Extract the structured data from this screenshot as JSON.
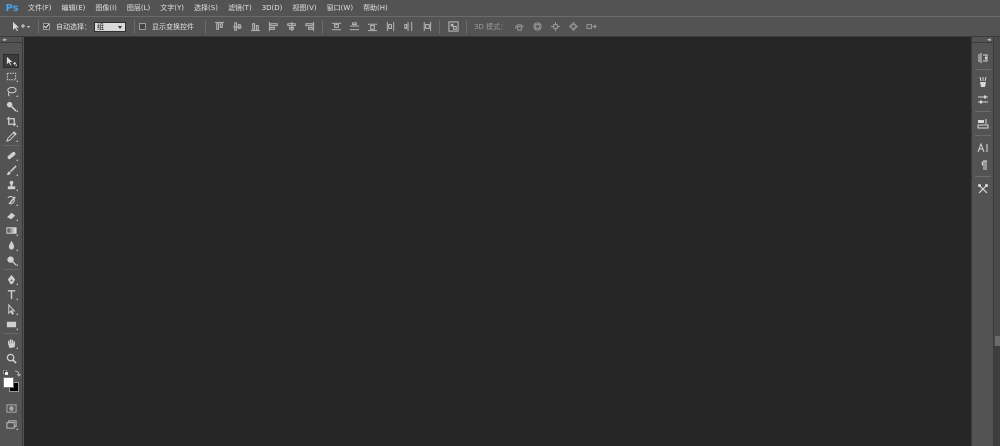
{
  "app": {
    "logo": "Ps"
  },
  "menu": [
    "文件(F)",
    "编辑(E)",
    "图像(I)",
    "图层(L)",
    "文字(Y)",
    "选择(S)",
    "滤镜(T)",
    "3D(D)",
    "视图(V)",
    "窗口(W)",
    "帮助(H)"
  ],
  "options_bar": {
    "auto_select_label": "自动选择：",
    "auto_select_checked": true,
    "auto_select_value": "组",
    "show_transform_label": "显示变换控件",
    "show_transform_checked": false,
    "mode_3d_label": "3D 模式："
  },
  "toolbar": {
    "tools": [
      "move-tool",
      "marquee-tool",
      "lasso-tool",
      "quick-select-tool",
      "crop-tool",
      "eyedropper-tool",
      "spot-healing-tool",
      "brush-tool",
      "clone-stamp-tool",
      "history-brush-tool",
      "eraser-tool",
      "gradient-tool",
      "blur-tool",
      "dodge-tool",
      "pen-tool",
      "type-tool",
      "path-select-tool",
      "rectangle-tool",
      "hand-tool",
      "zoom-tool"
    ],
    "foreground_color": "#ffffff",
    "background_color": "#000000"
  },
  "dock": {
    "panels": [
      "history-panel",
      "brushes-panel",
      "adjustments-panel",
      "properties-panel",
      "character-panel",
      "paragraph-panel",
      "tool-presets-panel"
    ]
  },
  "colors": {
    "workspace": "#262626",
    "chrome": "#535353",
    "logo": "#4aa3e8"
  }
}
